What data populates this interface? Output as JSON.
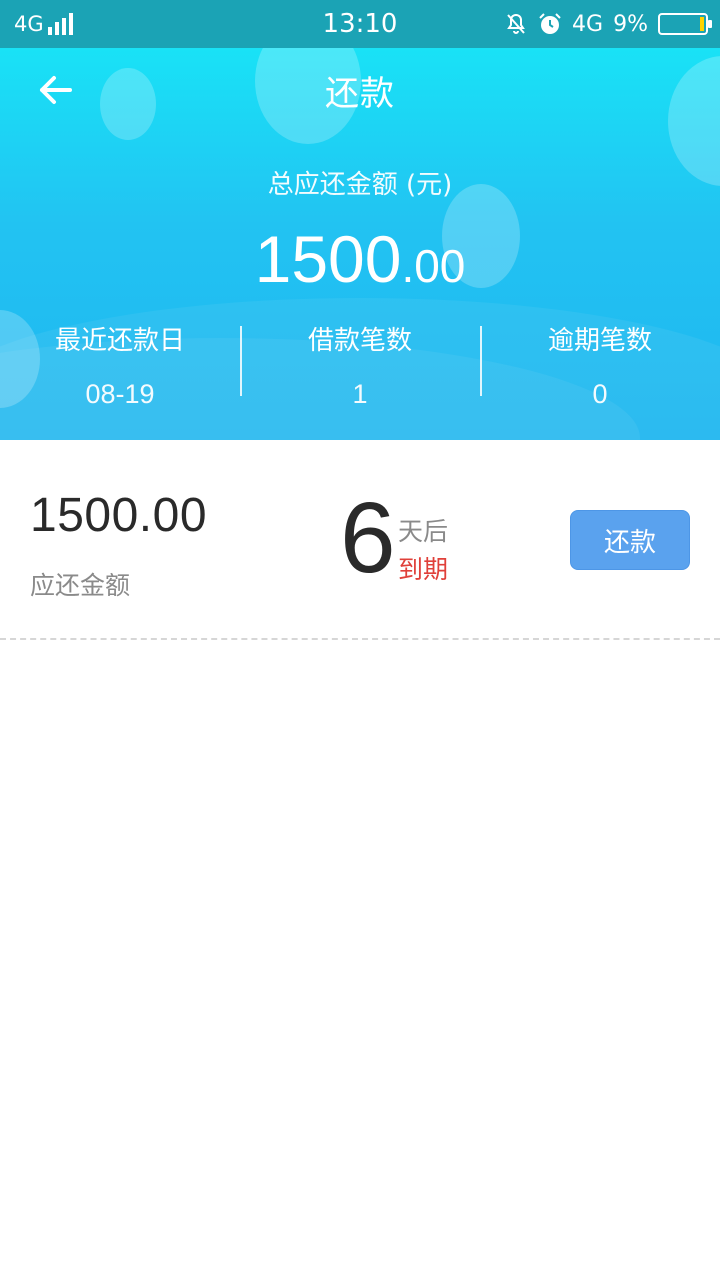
{
  "status_bar": {
    "network_left": "4G",
    "time": "13:10",
    "network_right": "4G",
    "battery": "9%",
    "icons": [
      "signal-icon",
      "mute-icon",
      "alarm-icon",
      "battery-icon"
    ]
  },
  "header": {
    "title": "还款",
    "total_label": "总应还金额 (元)",
    "total_integer": "1500",
    "total_decimal": ".00",
    "stats": [
      {
        "label": "最近还款日",
        "value": "08-19"
      },
      {
        "label": "借款笔数",
        "value": "1"
      },
      {
        "label": "逾期笔数",
        "value": "0"
      }
    ]
  },
  "loan": {
    "amount": "1500.00",
    "amount_label": "应还金额",
    "days": "6",
    "days_after": "天后",
    "due": "到期",
    "repay_button": "还款"
  },
  "colors": {
    "header_gradient_top": "#19e2f6",
    "header_gradient_bottom": "#1fb6f0",
    "status_bar": "#1ba3b5",
    "button": "#5aa2ee",
    "due_red": "#e0403a"
  }
}
